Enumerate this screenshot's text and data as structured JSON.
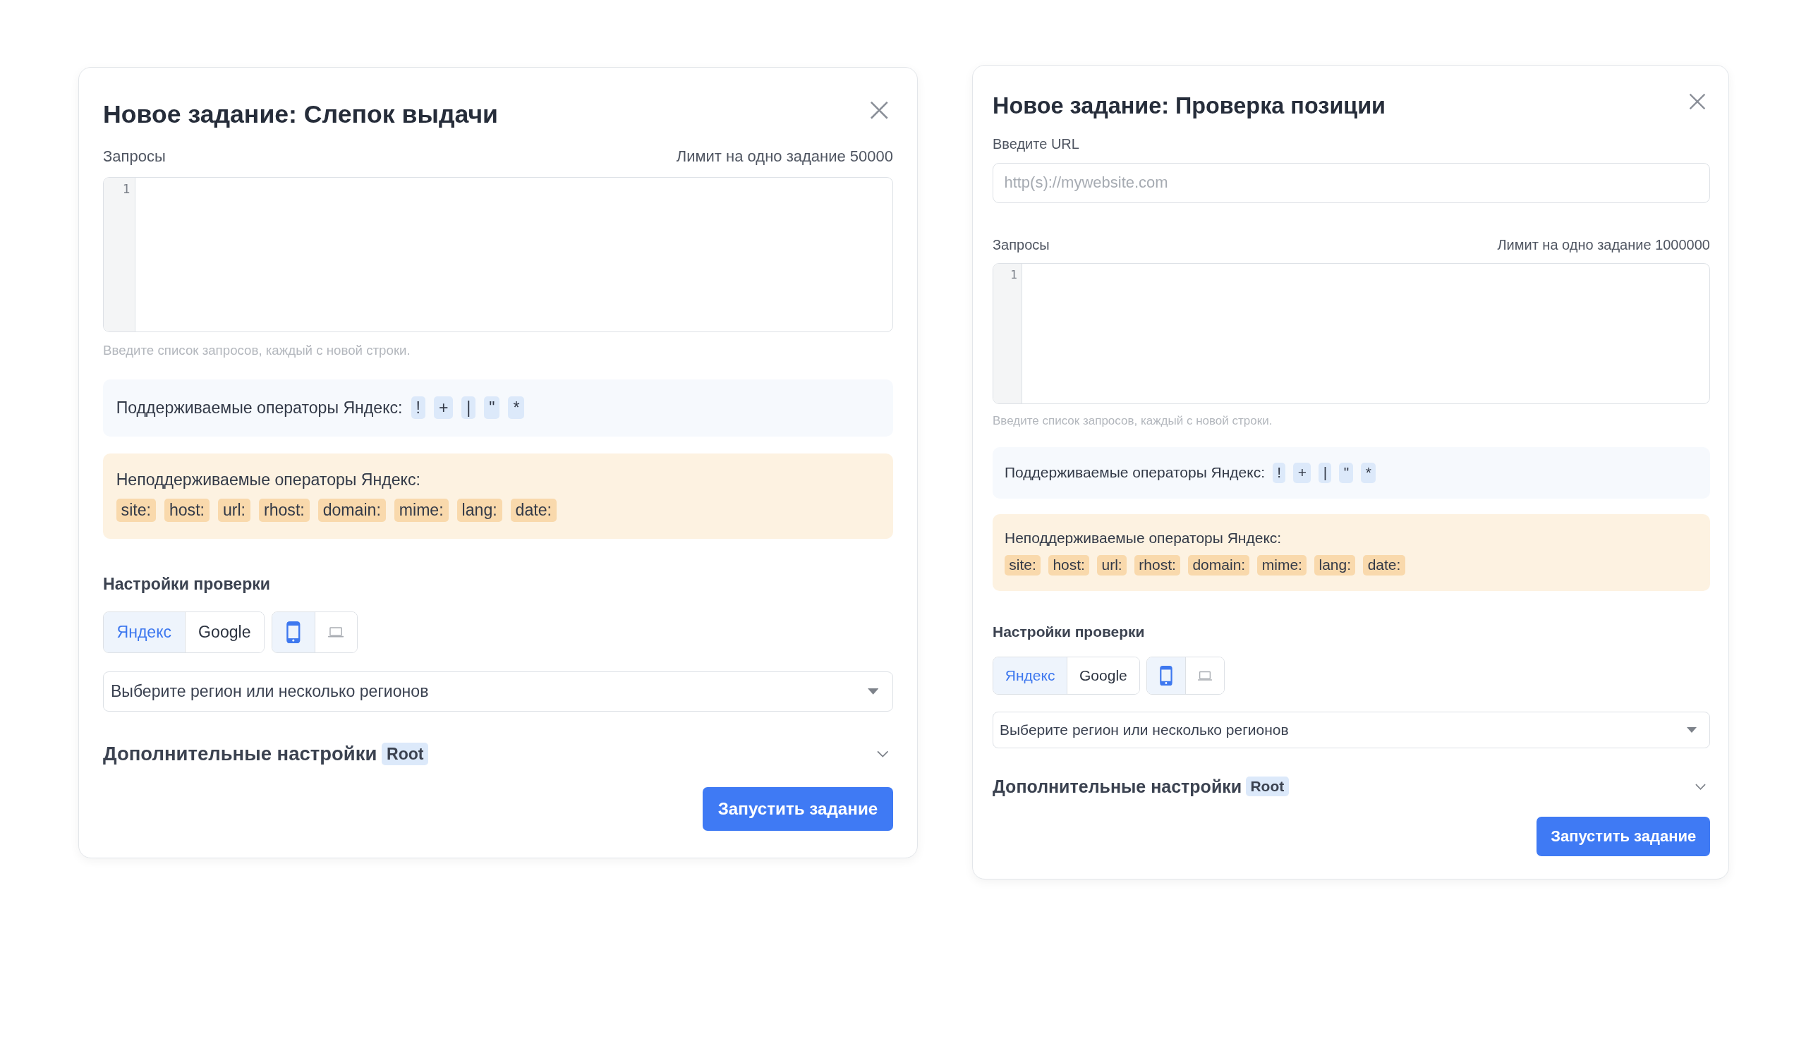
{
  "dialogs": [
    {
      "title": "Новое задание: Слепок выдачи",
      "queries": {
        "label": "Запросы",
        "limit": "Лимит на одно задание 50000",
        "line_number": "1",
        "hint": "Введите список запросов, каждый с новой строки."
      },
      "supported": {
        "label": "Поддерживаемые операторы Яндекс:",
        "operators": [
          "!",
          "+",
          "|",
          "\"",
          "*"
        ]
      },
      "unsupported": {
        "label": "Неподдерживаемые операторы Яндекс:",
        "operators": [
          "site:",
          "host:",
          "url:",
          "rhost:",
          "domain:",
          "mime:",
          "lang:",
          "date:"
        ]
      },
      "settings": {
        "heading": "Настройки проверки",
        "engines": [
          {
            "label": "Яндекс",
            "selected": true
          },
          {
            "label": "Google",
            "selected": false
          }
        ],
        "devices": [
          {
            "kind": "mobile",
            "selected": true
          },
          {
            "kind": "desktop",
            "selected": false
          }
        ],
        "region": {
          "placeholder": "Выберите регион или несколько регионов"
        }
      },
      "advanced": {
        "label": "Дополнительные настройки",
        "badge": "Root",
        "expanded": false
      },
      "submit": "Запустить задание"
    },
    {
      "title": "Новое задание: Проверка позиции",
      "url_field": {
        "label": "Введите URL",
        "placeholder": "http(s)://mywebsite.com"
      },
      "queries": {
        "label": "Запросы",
        "limit": "Лимит на одно задание 1000000",
        "line_number": "1",
        "hint": "Введите список запросов, каждый с новой строки."
      },
      "supported": {
        "label": "Поддерживаемые операторы Яндекс:",
        "operators": [
          "!",
          "+",
          "|",
          "\"",
          "*"
        ]
      },
      "unsupported": {
        "label": "Неподдерживаемые операторы Яндекс:",
        "operators": [
          "site:",
          "host:",
          "url:",
          "rhost:",
          "domain:",
          "mime:",
          "lang:",
          "date:"
        ]
      },
      "settings": {
        "heading": "Настройки проверки",
        "engines": [
          {
            "label": "Яндекс",
            "selected": true
          },
          {
            "label": "Google",
            "selected": false
          }
        ],
        "devices": [
          {
            "kind": "mobile",
            "selected": true
          },
          {
            "kind": "desktop",
            "selected": false
          }
        ],
        "region": {
          "placeholder": "Выберите регион или несколько регионов"
        }
      },
      "advanced": {
        "label": "Дополнительные настройки",
        "badge": "Root",
        "expanded": false
      },
      "submit": "Запустить задание"
    }
  ]
}
